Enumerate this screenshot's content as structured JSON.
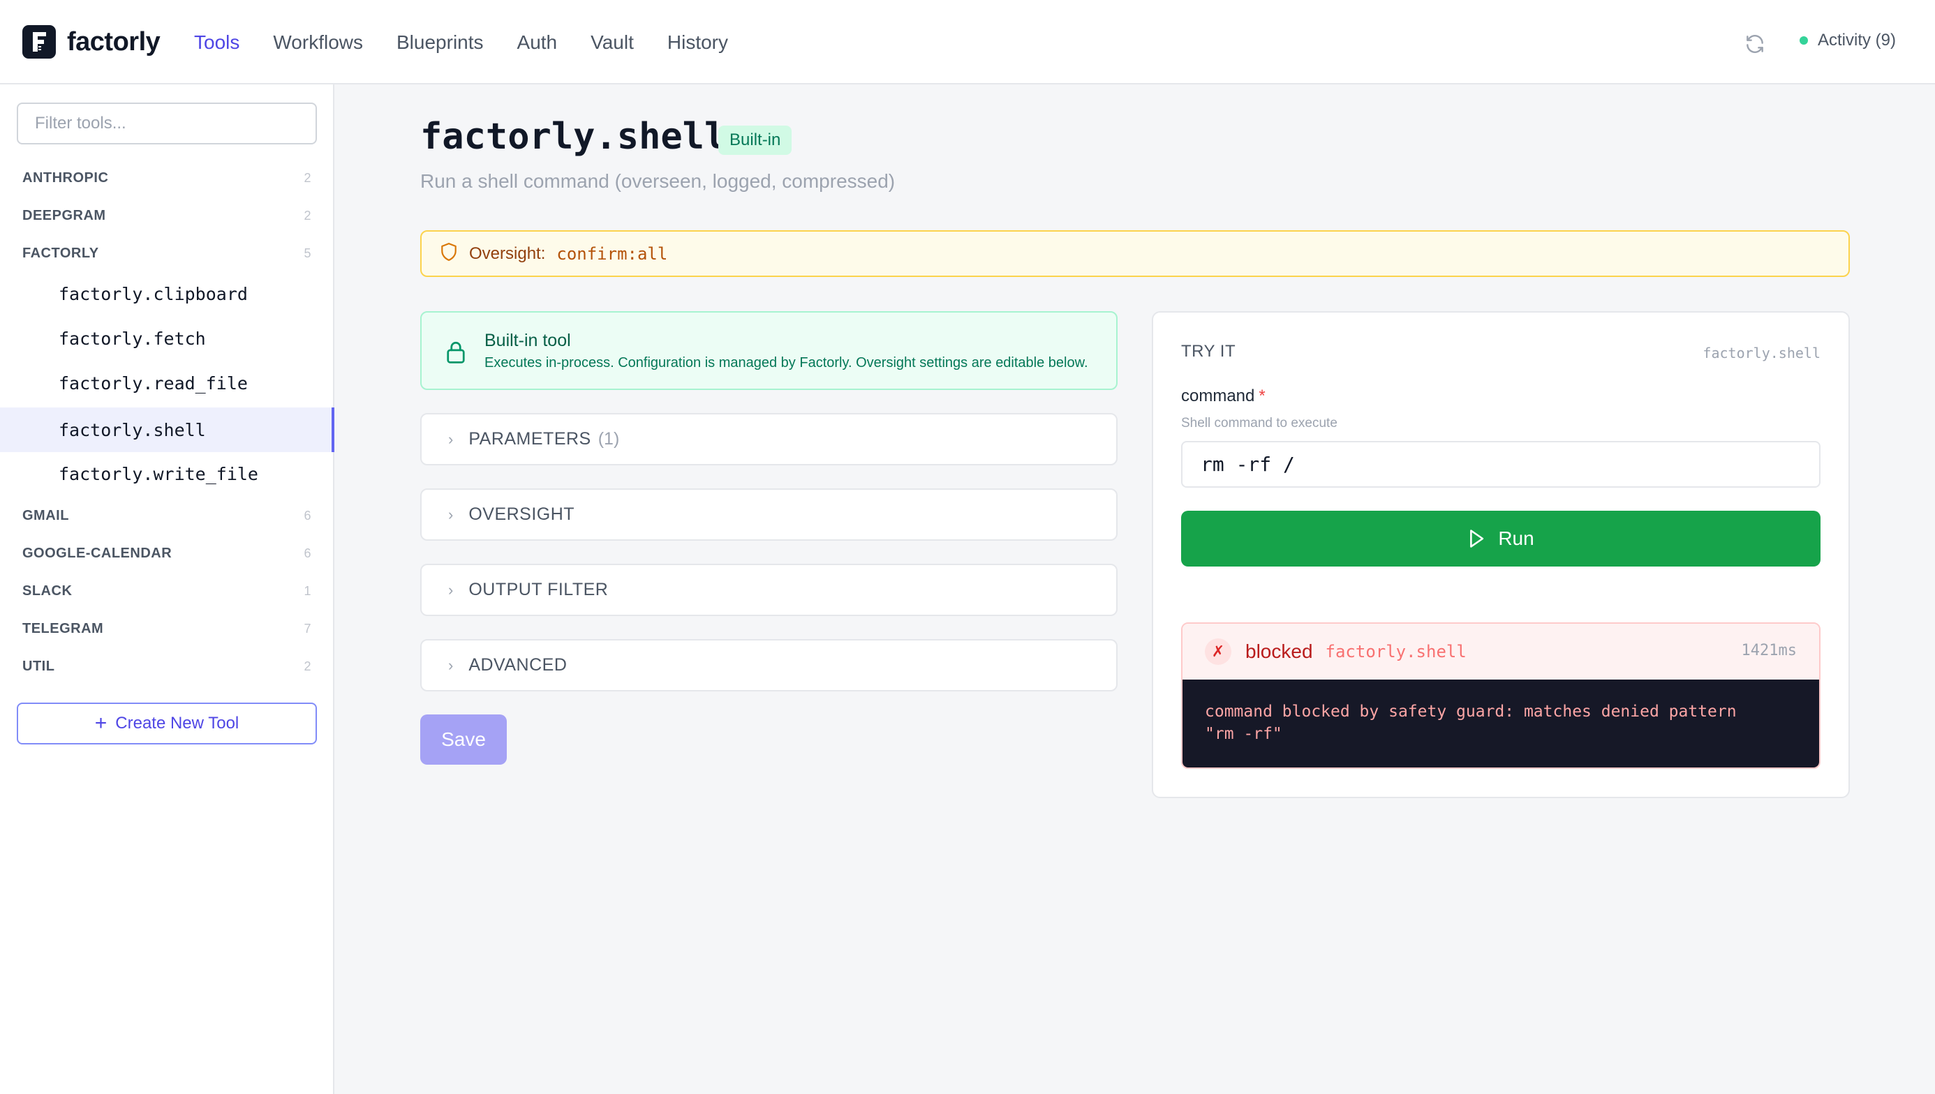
{
  "app": {
    "name": "factorly"
  },
  "nav": {
    "items": [
      {
        "label": "Tools",
        "active": true
      },
      {
        "label": "Workflows"
      },
      {
        "label": "Blueprints"
      },
      {
        "label": "Auth"
      },
      {
        "label": "Vault"
      },
      {
        "label": "History"
      }
    ]
  },
  "header": {
    "activity_label": "Activity (9)",
    "refresh_icon": "refresh-icon"
  },
  "sidebar": {
    "filter_placeholder": "Filter tools...",
    "groups": [
      {
        "label": "ANTHROPIC",
        "count": "2"
      },
      {
        "label": "DEEPGRAM",
        "count": "2"
      },
      {
        "label": "FACTORLY",
        "count": "5"
      },
      {
        "label": "GMAIL",
        "count": "6"
      },
      {
        "label": "GOOGLE-CALENDAR",
        "count": "6"
      },
      {
        "label": "SLACK",
        "count": "1"
      },
      {
        "label": "TELEGRAM",
        "count": "7"
      },
      {
        "label": "UTIL",
        "count": "2"
      }
    ],
    "factorly_tools": [
      {
        "label": "factorly.clipboard"
      },
      {
        "label": "factorly.fetch"
      },
      {
        "label": "factorly.read_file"
      },
      {
        "label": "factorly.shell",
        "selected": true
      },
      {
        "label": "factorly.write_file"
      }
    ],
    "create_label": "Create New Tool"
  },
  "tool": {
    "name": "factorly.shell",
    "badge": "Built-in",
    "description": "Run a shell command (overseen, logged, compressed)",
    "oversight_label": "Oversight:",
    "oversight_value": "confirm:all",
    "builtin_title": "Built-in tool",
    "builtin_desc": "Executes in-process. Configuration is managed by Factorly. Oversight settings are editable below.",
    "sections": [
      {
        "label": "PARAMETERS",
        "count": "(1)"
      },
      {
        "label": "OVERSIGHT",
        "count": ""
      },
      {
        "label": "OUTPUT FILTER",
        "count": ""
      },
      {
        "label": "ADVANCED",
        "count": ""
      }
    ],
    "save_label": "Save"
  },
  "try_it": {
    "label": "TRY IT",
    "tool_name": "factorly.shell",
    "field_label": "command",
    "required_mark": "*",
    "field_hint": "Shell command to execute",
    "command_value": "rm -rf /",
    "run_label": "Run",
    "result": {
      "status": "blocked",
      "status_icon": "✗",
      "tool": "factorly.shell",
      "duration": "1421ms",
      "message": "command blocked by safety guard: matches denied pattern\n\"rm -rf\""
    }
  },
  "colors": {
    "accent": "#4f46e5",
    "run_green": "#16a34a",
    "error_red": "#b91c1c",
    "warning_bg": "#fefbea"
  }
}
